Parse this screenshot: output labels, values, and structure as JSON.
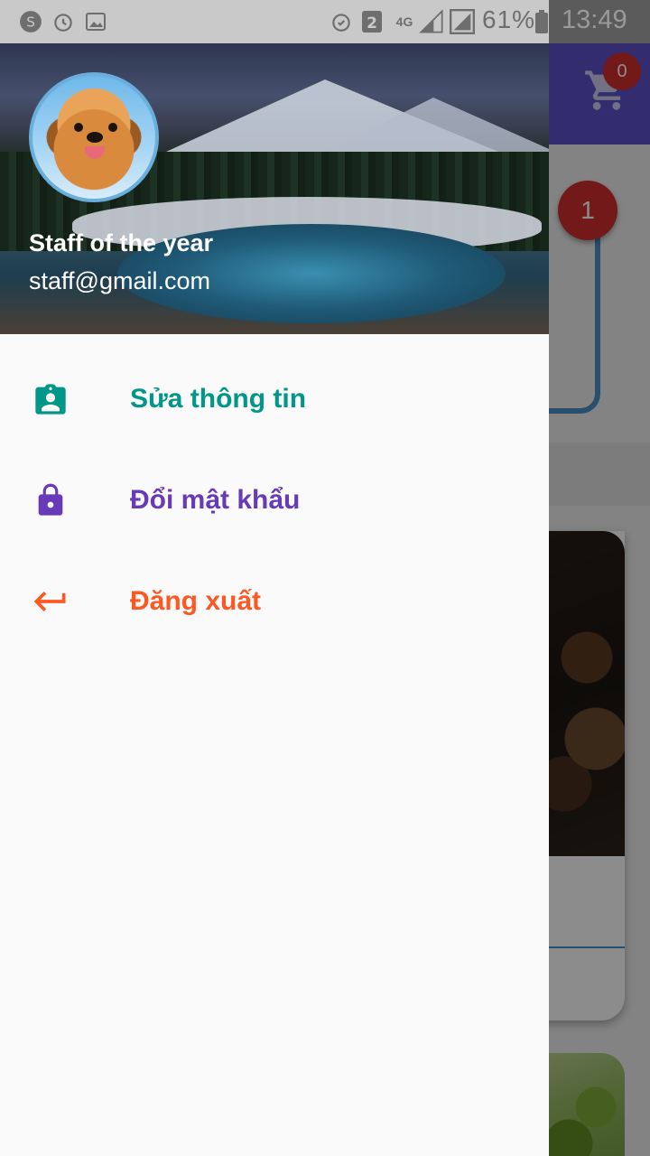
{
  "status_bar": {
    "sim": "2",
    "network": "4G",
    "battery": "61%",
    "time": "13:49"
  },
  "background": {
    "cart_count": "0",
    "card_badge": "1"
  },
  "drawer": {
    "header": {
      "name": "Staff of the year",
      "email": "staff@gmail.com"
    },
    "items": [
      {
        "label": "Sửa thông tin",
        "icon": "account-badge-icon",
        "color": "#009688"
      },
      {
        "label": "Đổi mật khẩu",
        "icon": "lock-icon",
        "color": "#673ab7"
      },
      {
        "label": "Đăng xuất",
        "icon": "logout-arrow-icon",
        "color": "#ff5722"
      }
    ]
  }
}
